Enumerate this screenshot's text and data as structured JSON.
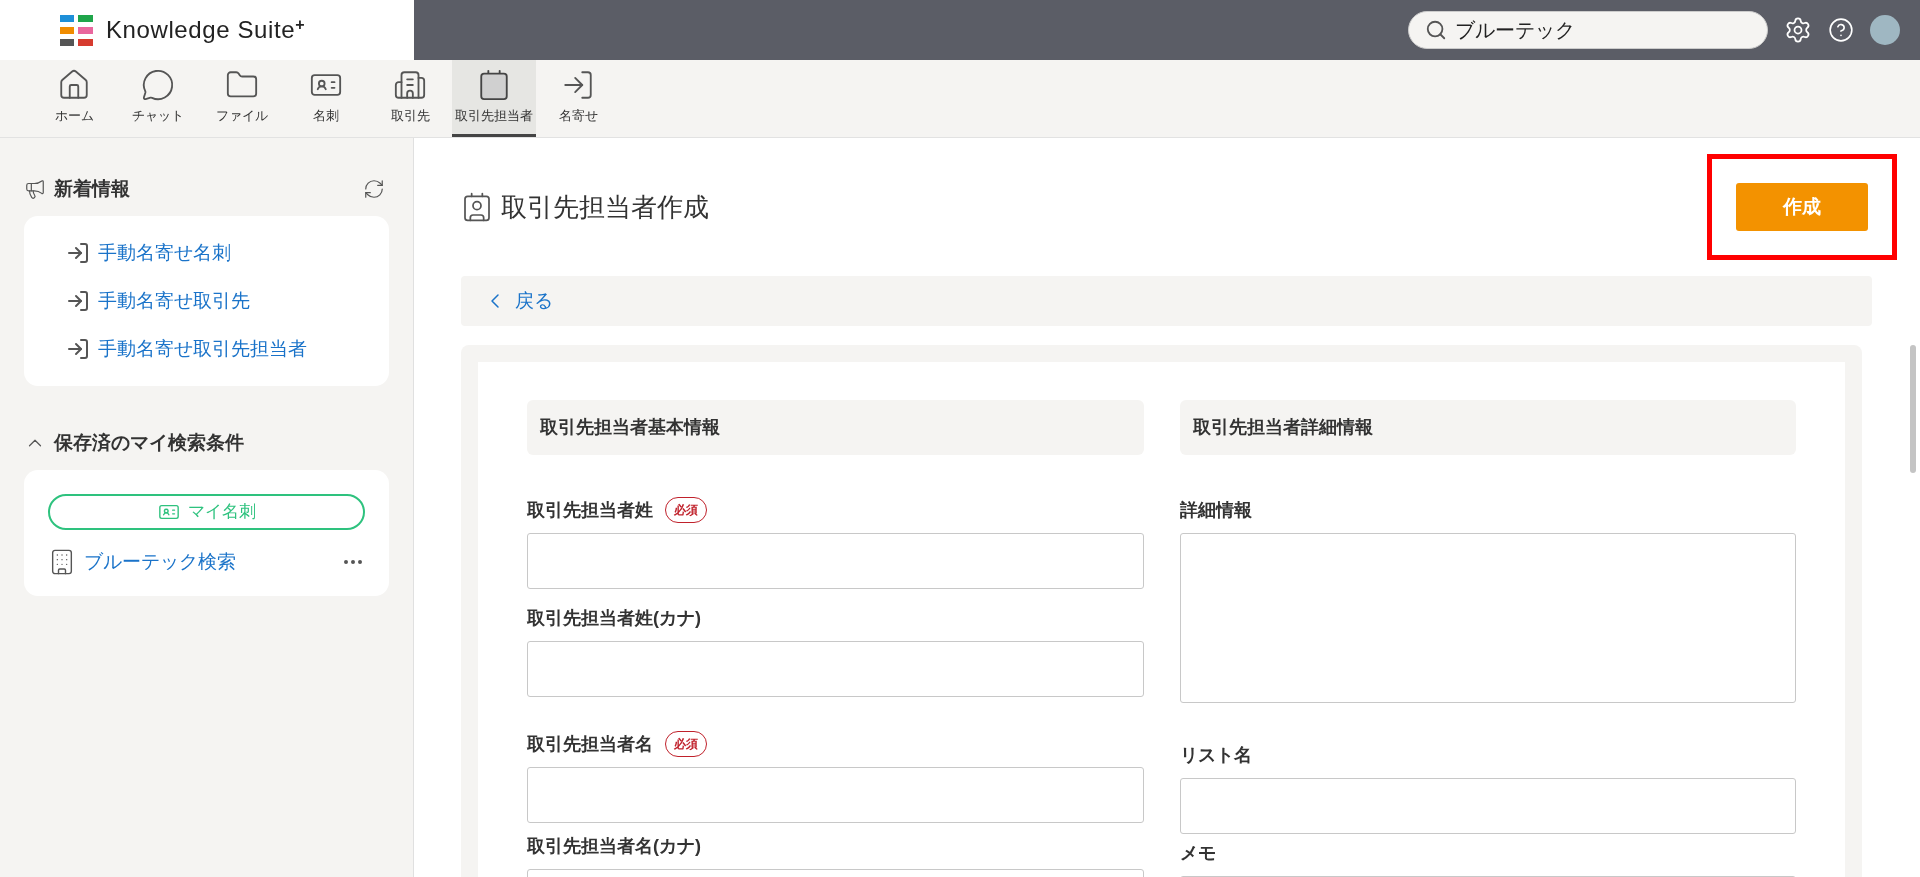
{
  "app": {
    "name": "Knowledge Suite",
    "mark": "+"
  },
  "search": {
    "value": "ブルーテック"
  },
  "nav": [
    {
      "label": "ホーム",
      "selected": false
    },
    {
      "label": "チャット",
      "selected": false
    },
    {
      "label": "ファイル",
      "selected": false
    },
    {
      "label": "名刺",
      "selected": false
    },
    {
      "label": "取引先",
      "selected": false
    },
    {
      "label": "取引先担当者",
      "selected": true
    },
    {
      "label": "名寄せ",
      "selected": false
    }
  ],
  "sidebar": {
    "news": {
      "title": "新着情報",
      "items": [
        "手動名寄せ名刺",
        "手動名寄せ取引先",
        "手動名寄せ取引先担当者"
      ]
    },
    "saved": {
      "title": "保存済のマイ検索条件",
      "expanded": true,
      "pill": "マイ名刺",
      "items": [
        "ブルーテック検索"
      ]
    }
  },
  "page": {
    "title": "取引先担当者作成",
    "create_button": {
      "label": "作成",
      "highlighted": true
    },
    "back": "戻る"
  },
  "form": {
    "columns": [
      {
        "heading": "取引先担当者基本情報",
        "fields": [
          {
            "label": "取引先担当者姓",
            "badge": "必須",
            "kind": "input"
          },
          {
            "label": "取引先担当者姓(カナ)",
            "kind": "input"
          },
          {
            "label": "取引先担当者名",
            "badge": "必須",
            "kind": "input"
          },
          {
            "label": "取引先担当者名(カナ)",
            "kind": "input"
          }
        ]
      },
      {
        "heading": "取引先担当者詳細情報",
        "fields": [
          {
            "label": "詳細情報",
            "kind": "textarea"
          },
          {
            "label": "リスト名",
            "kind": "input"
          },
          {
            "label": "メモ",
            "kind": "input"
          }
        ]
      }
    ]
  }
}
